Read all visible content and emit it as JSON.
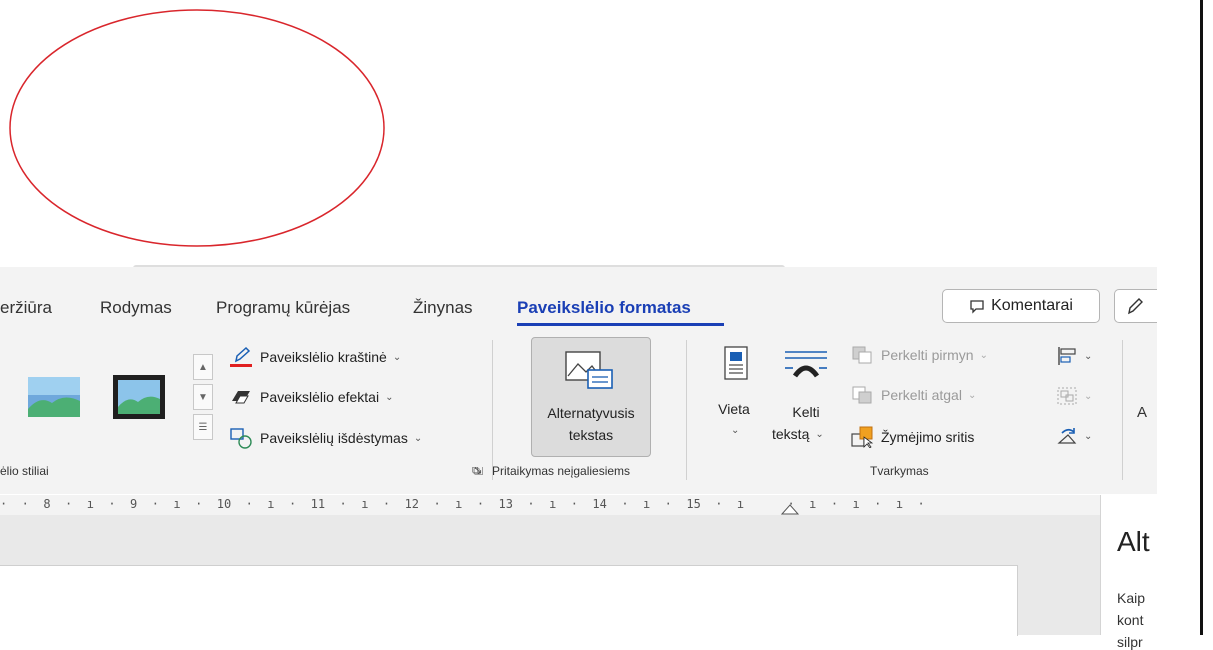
{
  "tabs": [
    {
      "label": "eržiūra",
      "active": false
    },
    {
      "label": "Rodymas",
      "active": false
    },
    {
      "label": "Programų kūrėjas",
      "active": false
    },
    {
      "label": "Žinynas",
      "active": false
    },
    {
      "label": "Paveikslėlio formatas",
      "active": true
    }
  ],
  "header": {
    "comments_label": "Komentarai",
    "accent_color": "#1a3fb5"
  },
  "picture_styles": {
    "border_label": "Paveikslėlio kraštinė",
    "effects_label": "Paveikslėlio efektai",
    "layout_label": "Paveikslėlių išdėstymas",
    "group_label": "ėlio stiliai"
  },
  "accessibility": {
    "alt_text_line1": "Alternatyvusis",
    "alt_text_line2": "tekstas",
    "group_label": "Pritaikymas neįgaliesiems"
  },
  "arrange": {
    "position_label": "Vieta",
    "wrap_line1": "Kelti",
    "wrap_line2": "tekstą",
    "bring_forward_label": "Perkelti pirmyn",
    "send_backward_label": "Perkelti atgal",
    "selection_pane_label": "Žymėjimo sritis",
    "group_label": "Tvarkymas"
  },
  "overflow_letter": "A",
  "ruler_text": "·  ·  8  ·  ı  ·  9  ·  ı  ·  10  ·  ı  ·  11  ·  ı  ·  12  ·  ı  ·  13  ·  ı  ·  14  ·  ı  ·  15  ·  ı      ·  ı  ·  ı  ·  ı  ·",
  "side_pane": {
    "title": "Alt",
    "lines": [
      "Kaip",
      "kont",
      "silpr"
    ]
  },
  "annotation_color": "#d9262c"
}
